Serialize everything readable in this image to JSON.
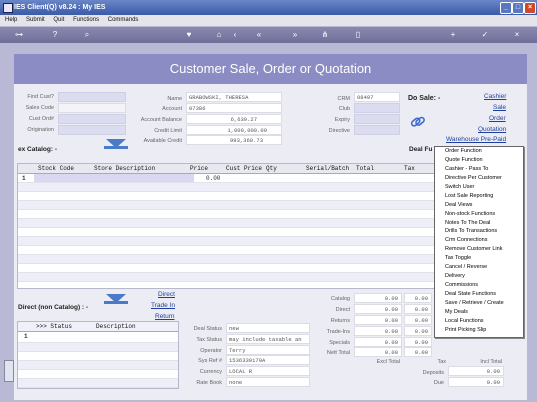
{
  "window": {
    "title": "IES Client(Q) v8.24 : My IES"
  },
  "menubar": [
    "Help",
    "Submit",
    "Quit",
    "Functions",
    "Commands"
  ],
  "page_title": "Customer Sale, Order or Quotation",
  "left_labels": {
    "find_cust": "Find Cust?",
    "sales_code": "Sales Code",
    "cust_ord": "Cust Ord#",
    "origination": "Origination"
  },
  "customer": {
    "name_label": "Name",
    "name": "GRABOWSKI, THERESA",
    "account_label": "Account",
    "account": "07386",
    "balance_label": "Account Balance",
    "balance": "6,639.27",
    "limit_label": "Credit Limit",
    "limit": "1,000,000.00",
    "available_label": "Available Credit",
    "available": "993,360.73"
  },
  "right_labels": {
    "crm": "CRM",
    "crm_value": "08497",
    "club": "Club",
    "expiry": "Expiry",
    "directive": "Directive"
  },
  "do_sale": {
    "label": "Do Sale: -",
    "links": [
      "Cashier",
      "Sale",
      "Order",
      "Quotation",
      "Warehouse Pre-Paid"
    ]
  },
  "catalog": {
    "label": "ex Catalog: -",
    "deal_functions": "Deal Fu",
    "columns": [
      "Stock Code",
      "Store Description",
      "Price",
      "Cust Price",
      "Qty",
      "Serial/Batch",
      "Total",
      "Tax"
    ],
    "row1_price": "0.00"
  },
  "direct": {
    "label": "Direct (non Catalog) : -",
    "links": [
      "Direct",
      "Trade In",
      "Return"
    ],
    "columns": [
      ">>> Status",
      "Description"
    ],
    "row_num": "1"
  },
  "deal": {
    "status_label": "Deal Status",
    "status": "new",
    "tax_label": "Tax Status",
    "tax": "may include taxable an",
    "operator_label": "Operator",
    "operator": "Terry",
    "sys_ref_label": "Sys Ref #",
    "sys_ref": "1536339179A",
    "currency_label": "Currency",
    "currency": "LOCAL R",
    "rate_label": "Rate Book",
    "rate": "none"
  },
  "totals": {
    "labels": [
      "Catalog",
      "Direct",
      "Returns",
      "Trade-Ins",
      "Specials",
      "Nett Total"
    ],
    "values": [
      "0.00",
      "0.00",
      "0.00",
      "0.00",
      "0.00",
      "0.00"
    ],
    "excl_total": "Excl Total",
    "tax": "Tax",
    "incl_total": "Incl Total",
    "deposits": "Deposits",
    "deposits_value": "0.00",
    "due": "Due",
    "due_value": "0.00"
  },
  "context_menu": [
    "Order Function",
    "Quote Function",
    "Cashier - Pass To",
    "Directive Per Customer",
    "Switch User",
    "Lost Sale Reporting",
    "Deal Views",
    "Non-stock Functions",
    "Notes To The Deal",
    "Drills To Transactions",
    "Crm Connections",
    "Remove Customer Link",
    "Tax Toggle",
    "Cancel / Reverse",
    "Delivery",
    "Commissions",
    "Deal State Functions",
    "Save / Retrieve / Create",
    "My Deals",
    "Local Functions",
    "Print Picking Slip"
  ],
  "colors": {
    "header": "#8c8cc4",
    "panel": "#ececf4",
    "link": "#1f3f9f",
    "arrow": "#4a7ac8"
  }
}
